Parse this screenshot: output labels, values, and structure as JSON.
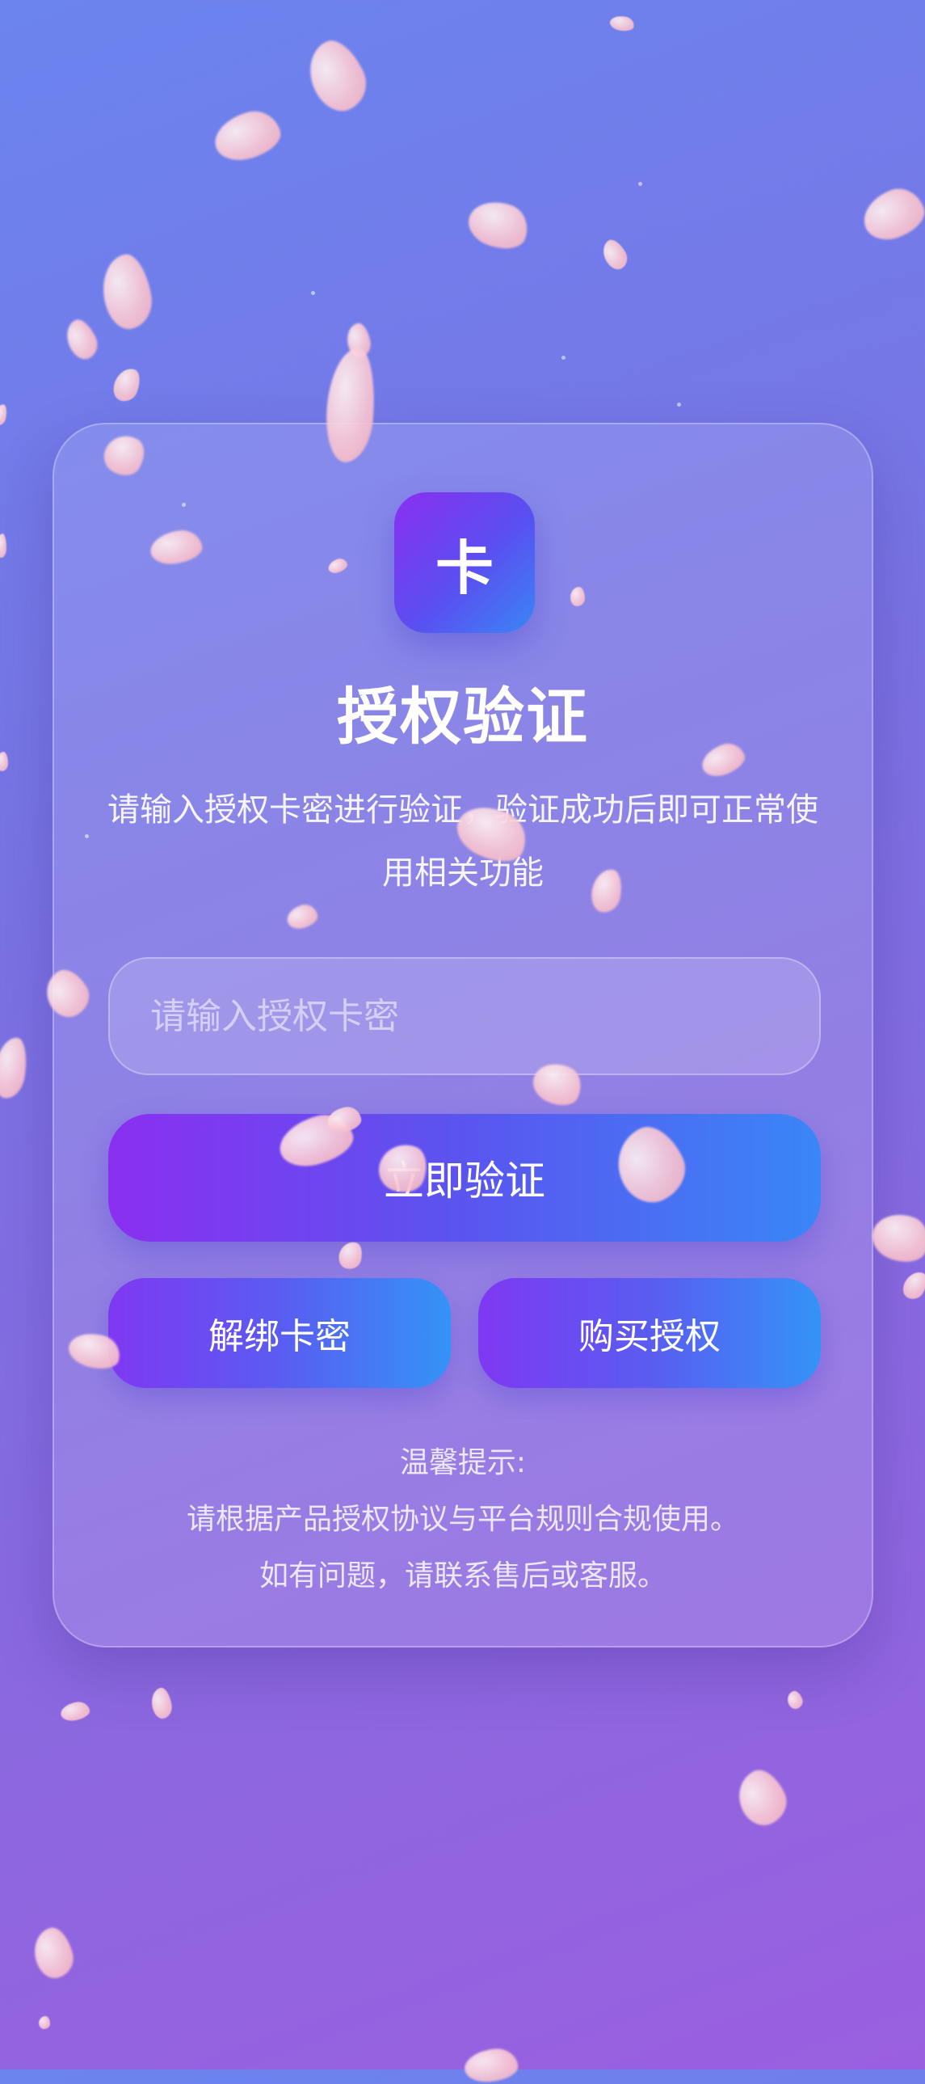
{
  "logo": {
    "char": "卡"
  },
  "header": {
    "title": "授权验证",
    "description": "请输入授权卡密进行验证，验证成功后即可正常使用相关功能"
  },
  "form": {
    "input_value": "",
    "input_placeholder": "请输入授权卡密",
    "verify_label": "立即验证",
    "unbind_label": "解绑卡密",
    "buy_label": "购买授权"
  },
  "tips": {
    "heading": "温馨提示:",
    "line1": "请根据产品授权协议与平台规则合规使用。",
    "line2": "如有问题，请联系售后或客服。"
  },
  "colors": {
    "background_top": "#6b84ef",
    "background_bottom": "#9a5fe0",
    "accent_purple": "#8a2ff0",
    "accent_blue": "#3a86f5",
    "petal": "#f8c6d3"
  }
}
